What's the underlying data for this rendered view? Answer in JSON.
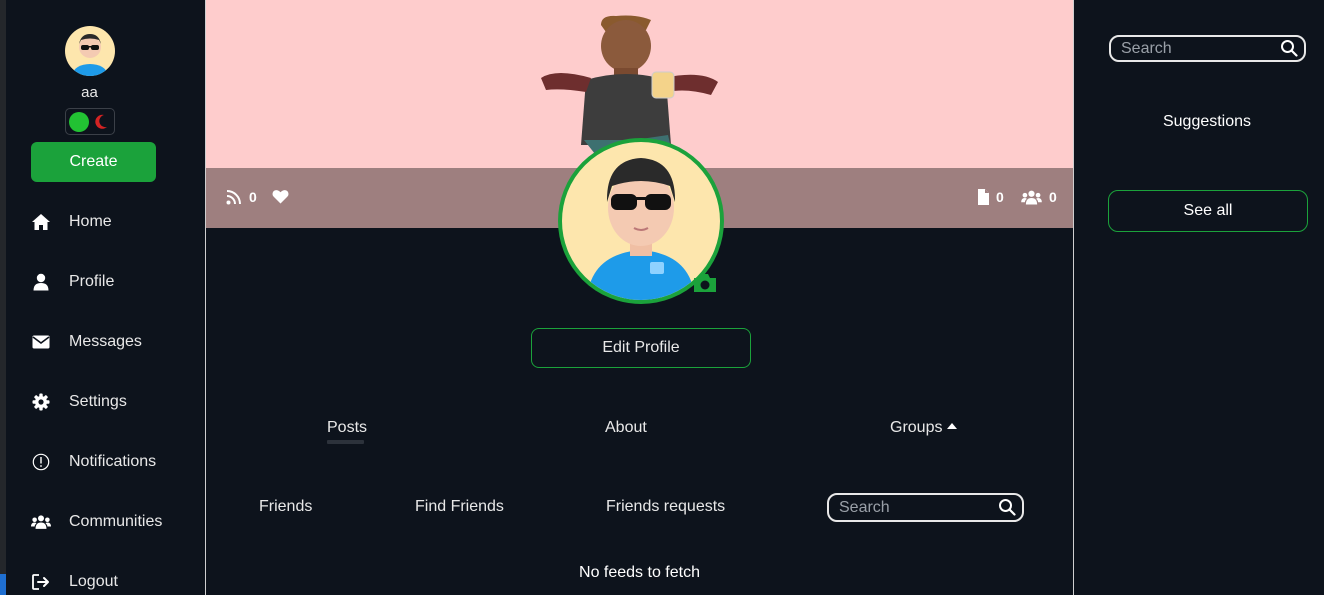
{
  "user": {
    "name": "aa"
  },
  "sidebar": {
    "create_label": "Create",
    "items": [
      {
        "label": "Home",
        "icon": "home-icon"
      },
      {
        "label": "Profile",
        "icon": "user-icon"
      },
      {
        "label": "Messages",
        "icon": "envelope-icon"
      },
      {
        "label": "Settings",
        "icon": "gear-icon"
      },
      {
        "label": "Notifications",
        "icon": "exclamation-circle-icon"
      },
      {
        "label": "Communities",
        "icon": "users-icon"
      },
      {
        "label": "Logout",
        "icon": "logout-icon"
      }
    ]
  },
  "profile": {
    "stats": {
      "feeds": "0",
      "likes_icon": "heart-icon",
      "posts": "0",
      "friends": "0"
    },
    "edit_label": "Edit Profile",
    "tabs": [
      "Posts",
      "About",
      "Groups"
    ],
    "subtabs": [
      "Friends",
      "Find Friends",
      "Friends requests"
    ],
    "search_placeholder": "Search",
    "empty_message": "No feeds to fetch"
  },
  "right": {
    "search_placeholder": "Search",
    "suggestions_title": "Suggestions",
    "see_all_label": "See all"
  },
  "colors": {
    "accent": "#1ba23b",
    "background": "#0d131c",
    "cover": "#fecccc",
    "stats_bar": "#9e7f7f",
    "avatar_bg": "#fde6ad",
    "toggle_moon": "#d42323"
  }
}
